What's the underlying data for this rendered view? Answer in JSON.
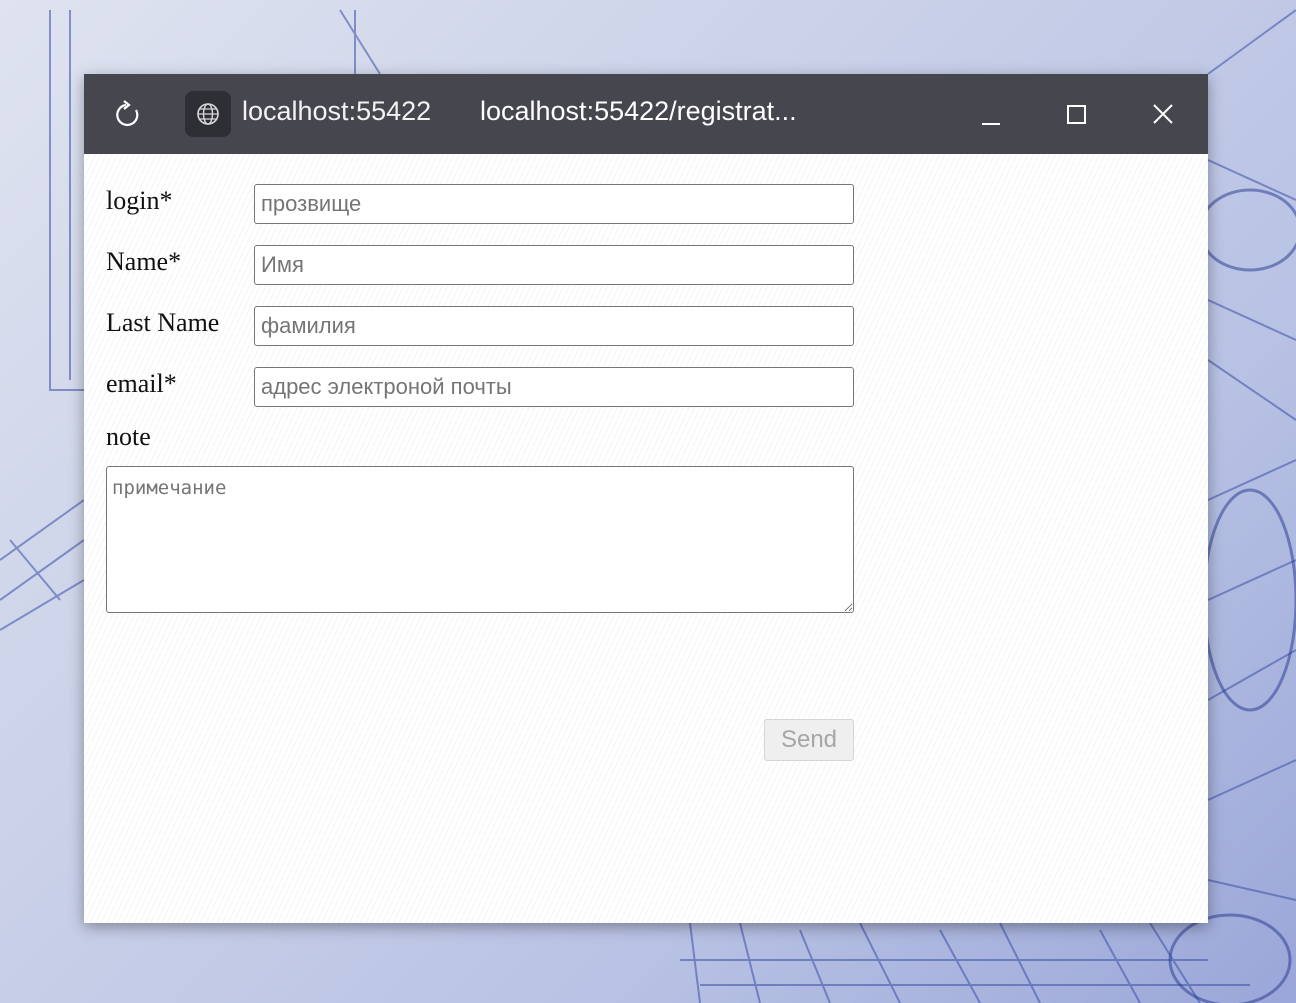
{
  "window": {
    "site_label": "localhost:55422",
    "url": "localhost:55422/registrat...",
    "icons": {
      "reload": "reload-icon",
      "site": "globe-icon",
      "minimize": "minimize-icon",
      "maximize": "maximize-icon",
      "close": "close-icon"
    }
  },
  "form": {
    "login": {
      "label": "login*",
      "placeholder": "прозвище",
      "value": ""
    },
    "name": {
      "label": "Name*",
      "placeholder": "Имя",
      "value": ""
    },
    "last_name": {
      "label": "Last Name",
      "placeholder": "фамилия",
      "value": ""
    },
    "email": {
      "label": "email*",
      "placeholder": "адрес электроной почты",
      "value": ""
    },
    "note": {
      "label": "note",
      "placeholder": "примечание",
      "value": ""
    },
    "send_label": "Send",
    "send_disabled": true
  },
  "colors": {
    "titlebar": "#45464e",
    "window_bg": "#ffffff",
    "desktop_accent": "#3a4fa8"
  }
}
